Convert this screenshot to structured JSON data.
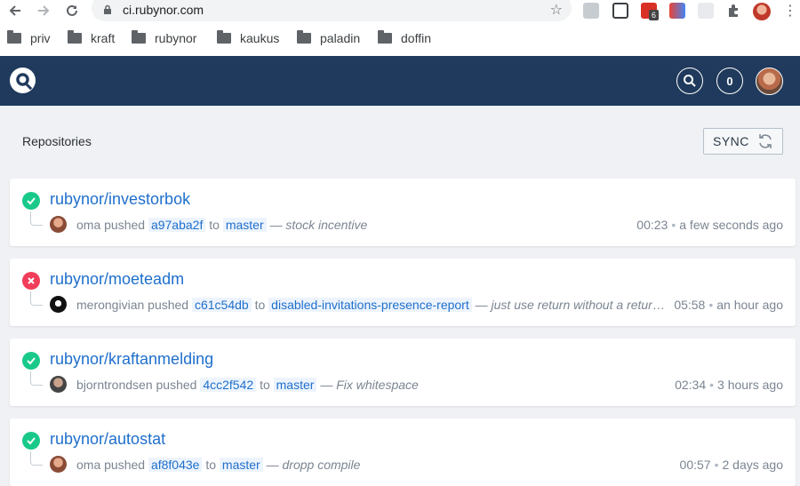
{
  "browser": {
    "url": "ci.rubynor.com",
    "extension_badge": "6",
    "bookmarks": [
      "priv",
      "kraft",
      "rubynor",
      "kaukus",
      "paladin",
      "doffin"
    ]
  },
  "header": {
    "notification_count": "0"
  },
  "main": {
    "title": "Repositories",
    "sync_label": "SYNC"
  },
  "repos": [
    {
      "name": "rubynor/investorbok",
      "status": "success",
      "user": "oma",
      "action": "pushed",
      "commit": "a97aba2f",
      "to": "to",
      "branch": "master",
      "sep": "—",
      "message": "stock incentive",
      "duration": "00:23",
      "ago": "a few seconds ago"
    },
    {
      "name": "rubynor/moeteadm",
      "status": "failure",
      "user": "merongivian",
      "action": "pushed",
      "commit": "c61c54db",
      "to": "to",
      "branch": "disabled-invitations-presence-report",
      "sep": "—",
      "message": "just use return without a return value",
      "duration": "05:58",
      "ago": "an hour ago"
    },
    {
      "name": "rubynor/kraftanmelding",
      "status": "success",
      "user": "bjorntrondsen",
      "action": "pushed",
      "commit": "4cc2f542",
      "to": "to",
      "branch": "master",
      "sep": "—",
      "message": "Fix whitespace",
      "duration": "02:34",
      "ago": "3 hours ago"
    },
    {
      "name": "rubynor/autostat",
      "status": "success",
      "user": "oma",
      "action": "pushed",
      "commit": "af8f043e",
      "to": "to",
      "branch": "master",
      "sep": "—",
      "message": "dropp compile",
      "duration": "00:57",
      "ago": "2 days ago"
    }
  ],
  "colors": {
    "header": "#1f3a5c",
    "success": "#19c98a",
    "failure": "#f03d59",
    "link": "#1f6fcc"
  }
}
